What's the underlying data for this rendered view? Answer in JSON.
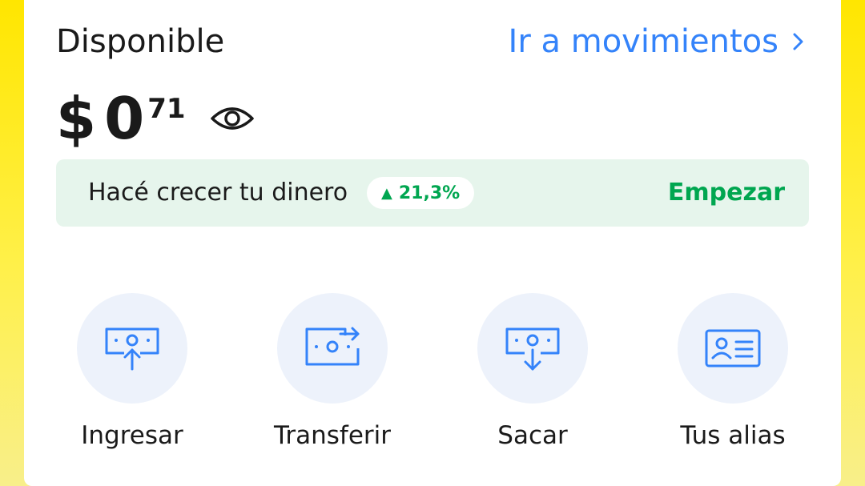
{
  "account": {
    "available_label": "Disponible",
    "movements_link": "Ir a movimientos",
    "balance": {
      "currency": "$",
      "whole": "0",
      "cents": "71"
    }
  },
  "promo": {
    "text": "Hacé crecer tu dinero",
    "badge_arrow": "▲",
    "badge_value": "21,3%",
    "cta": "Empezar"
  },
  "actions": [
    {
      "label": "Ingresar",
      "icon": "deposit-bill-icon"
    },
    {
      "label": "Transferir",
      "icon": "transfer-bill-icon"
    },
    {
      "label": "Sacar",
      "icon": "withdraw-bill-icon"
    },
    {
      "label": "Tus alias",
      "icon": "id-card-icon"
    }
  ],
  "colors": {
    "accent_blue": "#3483fa",
    "positive_green": "#00a650",
    "promo_background": "#e6f5ec",
    "action_circle": "#edf2fb",
    "brand_yellow": "#ffe600"
  }
}
